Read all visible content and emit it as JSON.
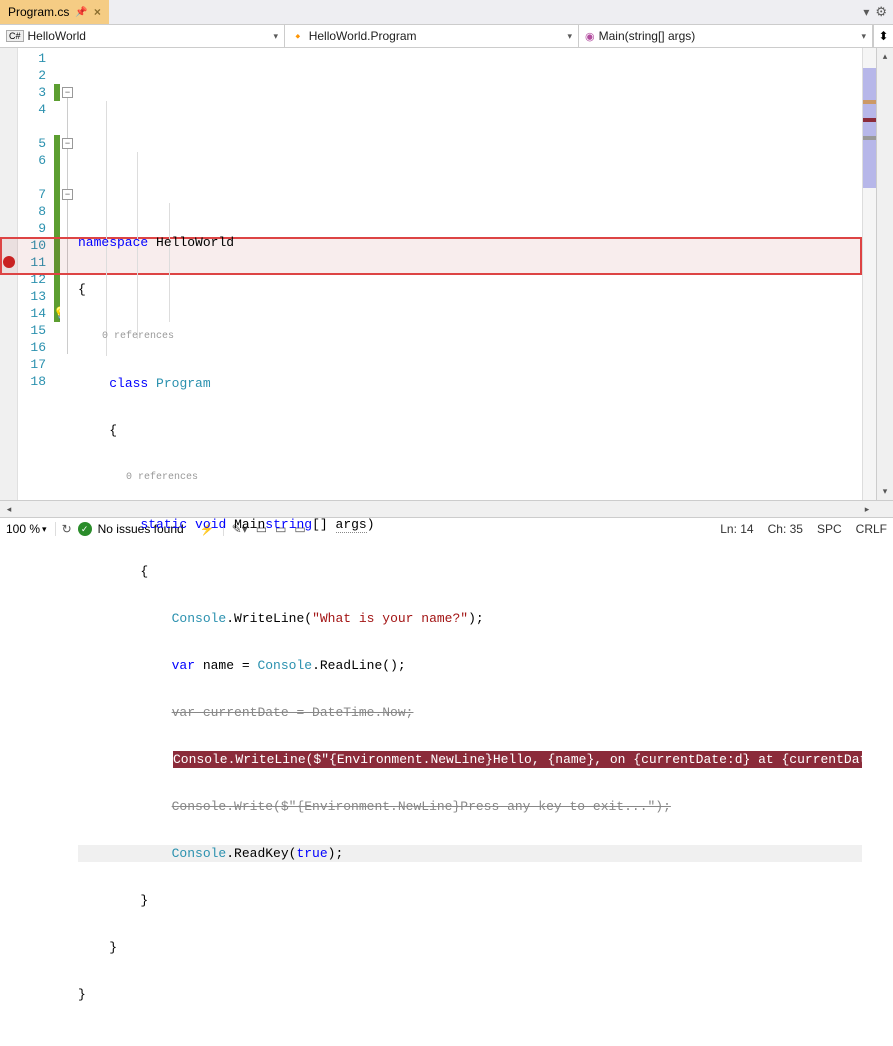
{
  "tab": {
    "filename": "Program.cs",
    "pinned": true
  },
  "nav": {
    "lang_icon": "C#",
    "namespace": "HelloWorld",
    "class_icon": "🔶",
    "class": "HelloWorld.Program",
    "method_icon": "🔘",
    "method": "Main(string[] args)"
  },
  "code": {
    "line3": {
      "kw": "namespace",
      "name": "HelloWorld"
    },
    "line4": "{",
    "codelens1": "0 references",
    "line5": {
      "kw": "class",
      "name": "Program"
    },
    "line6": "{",
    "codelens2": "0 references",
    "line7": {
      "kw1": "static",
      "kw2": "void",
      "name": "Main",
      "params": "(string[] args)"
    },
    "line8": "{",
    "line9": {
      "obj": "Console",
      "method": ".WriteLine(",
      "str": "\"What is your name?\"",
      "end": ");"
    },
    "line10": {
      "kw": "var",
      "var": " name = ",
      "obj": "Console",
      "method": ".ReadLine();"
    },
    "line11": "var currentDate = DateTime.Now;",
    "line12": "Console.WriteLine($\"{Environment.NewLine}Hello, {name}, on {currentDate:d} at {currentDate:t}!\");",
    "line13": "Console.Write($\"{Environment.NewLine}Press any key to exit...\");",
    "line14": {
      "obj": "Console",
      "method": ".ReadKey(",
      "kw": "true",
      "end": ");"
    },
    "line15": "}",
    "line16": "}",
    "line17": "}"
  },
  "line_numbers": [
    1,
    2,
    3,
    4,
    5,
    6,
    7,
    8,
    9,
    10,
    11,
    12,
    13,
    14,
    15,
    16,
    17,
    18
  ],
  "breakpoint_line": 12,
  "status": {
    "zoom": "100 %",
    "issues": "No issues found",
    "ln": "Ln: 14",
    "ch": "Ch: 35",
    "spc": "SPC",
    "crlf": "CRLF"
  }
}
